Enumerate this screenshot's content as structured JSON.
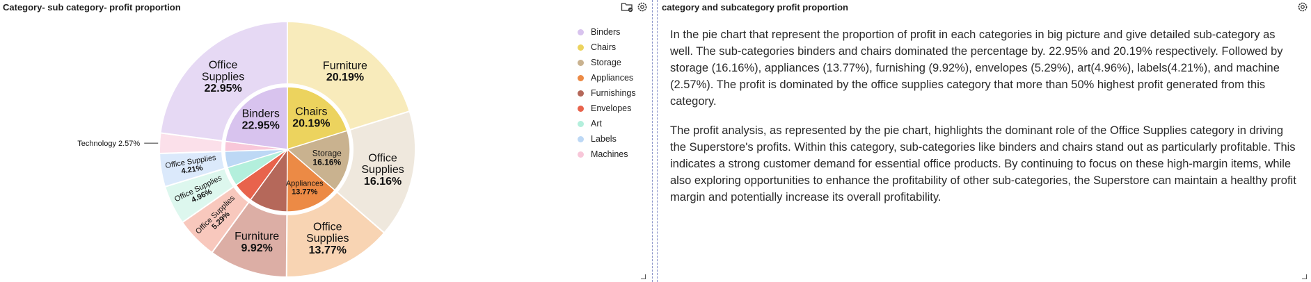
{
  "left_panel": {
    "title": "Category- sub category- profit proportion"
  },
  "right_panel": {
    "title": "category and subcategory profit proportion",
    "paragraphs": [
      "In the pie chart that represent the proportion of profit in each categories in big picture and give detailed sub-category as well. The sub-categories binders and chairs dominated the percentage by. 22.95% and 20.19% respectively. Followed by storage (16.16%), appliances (13.77%), furnishing (9.92%), envelopes (5.29%), art(4.96%), labels(4.21%), and machine (2.57%). The profit is dominated by the office supplies category that more than 50% highest profit generated from this category.",
      "The profit analysis, as represented by the pie chart, highlights the dominant role of the Office Supplies category in driving the Superstore's profits. Within this category, sub-categories like binders and chairs stand out as particularly profitable. This indicates a strong customer demand for essential office products. By continuing to focus on these high-margin items, while also exploring opportunities to enhance the profitability of other sub-categories, the Superstore can maintain a healthy profit margin and potentially increase its overall profitability."
    ]
  },
  "icons": {
    "folder": "folder-check-icon",
    "settings": "gear-icon"
  },
  "chart_data": {
    "type": "pie",
    "title": "Category- sub category- profit proportion",
    "inner": [
      {
        "name": "Binders",
        "value": 22.95,
        "label": "22.95%",
        "color": "#d8c3ee"
      },
      {
        "name": "Chairs",
        "value": 20.19,
        "label": "20.19%",
        "color": "#ecd35e"
      },
      {
        "name": "Storage",
        "value": 16.16,
        "label": "16.16%",
        "color": "#c9b28f"
      },
      {
        "name": "Appliances",
        "value": 13.77,
        "label": "13.77%",
        "color": "#ec8a45"
      },
      {
        "name": "Furnishings",
        "value": 9.92,
        "label": "",
        "color": "#b5685a"
      },
      {
        "name": "Envelopes",
        "value": 5.29,
        "label": "",
        "color": "#e8634c"
      },
      {
        "name": "Art",
        "value": 4.96,
        "label": "",
        "color": "#b3efdc"
      },
      {
        "name": "Labels",
        "value": 4.21,
        "label": "",
        "color": "#bdd8f5"
      },
      {
        "name": "Machines",
        "value": 2.57,
        "label": "",
        "color": "#f8c7d9"
      }
    ],
    "outer": [
      {
        "category": "Furniture",
        "value": 20.19,
        "label": "20.19%",
        "color": "#f8ebbb"
      },
      {
        "category": "Office Supplies",
        "value": 16.16,
        "label": "16.16%",
        "color": "#efe8dd"
      },
      {
        "category": "Office Supplies",
        "value": 13.77,
        "label": "13.77%",
        "color": "#f8d4b3"
      },
      {
        "category": "Furniture",
        "value": 9.92,
        "label": "9.92%",
        "color": "#dcaea5"
      },
      {
        "category": "Office Supplies",
        "value": 5.29,
        "label": "5.29%",
        "color": "#f8c8bd"
      },
      {
        "category": "Office Supplies",
        "value": 4.96,
        "label": "4.96%",
        "color": "#ddf7ee"
      },
      {
        "category": "Office Supplies",
        "value": 4.21,
        "label": "4.21%",
        "color": "#dbe9fb"
      },
      {
        "category": "Technology",
        "value": 2.57,
        "label": "2.57%",
        "color": "#fbe0ea"
      },
      {
        "category": "Office Supplies",
        "value": 22.95,
        "label": "22.95%",
        "color": "#e6d9f4"
      }
    ],
    "legend": [
      "Binders",
      "Chairs",
      "Storage",
      "Appliances",
      "Furnishings",
      "Envelopes",
      "Art",
      "Labels",
      "Machines"
    ],
    "legend_placement": "right"
  }
}
